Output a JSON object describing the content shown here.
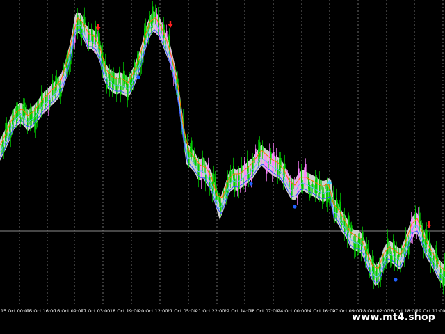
{
  "time_axis": {
    "labels": [
      "15 Oct 00:00",
      "15 Oct 16:00",
      "16 Oct 09:00",
      "17 Oct 03:00",
      "18 Oct 19:00",
      "20 Oct 12:00",
      "21 Oct 05:00",
      "21 Oct 22:00",
      "22 Oct 14:00",
      "23 Oct 07:00",
      "24 Oct 00:00",
      "24 Oct 16:00",
      "27 Oct 09:00",
      "28 Oct 02:00",
      "28 Oct 18:00",
      "29 Oct 11:00"
    ]
  },
  "watermark": "www.mt4.shop",
  "colors": {
    "background": "#000000",
    "grid": "#8c8c8c",
    "candle": "#00d000",
    "band_fill": "#cfcfcf",
    "highlight": "#ff80ff",
    "line_blue": "#3050ff",
    "line_cyan": "#60b8ff",
    "line_orange": "#ff7000",
    "arrow_sell": "#ff2020",
    "arrow_buy": "#2060ff"
  },
  "icons": {
    "sell_arrows": "down-arrow-red",
    "buy_markers": "dot-blue",
    "neutral_marker": "triangle-cyan"
  }
}
